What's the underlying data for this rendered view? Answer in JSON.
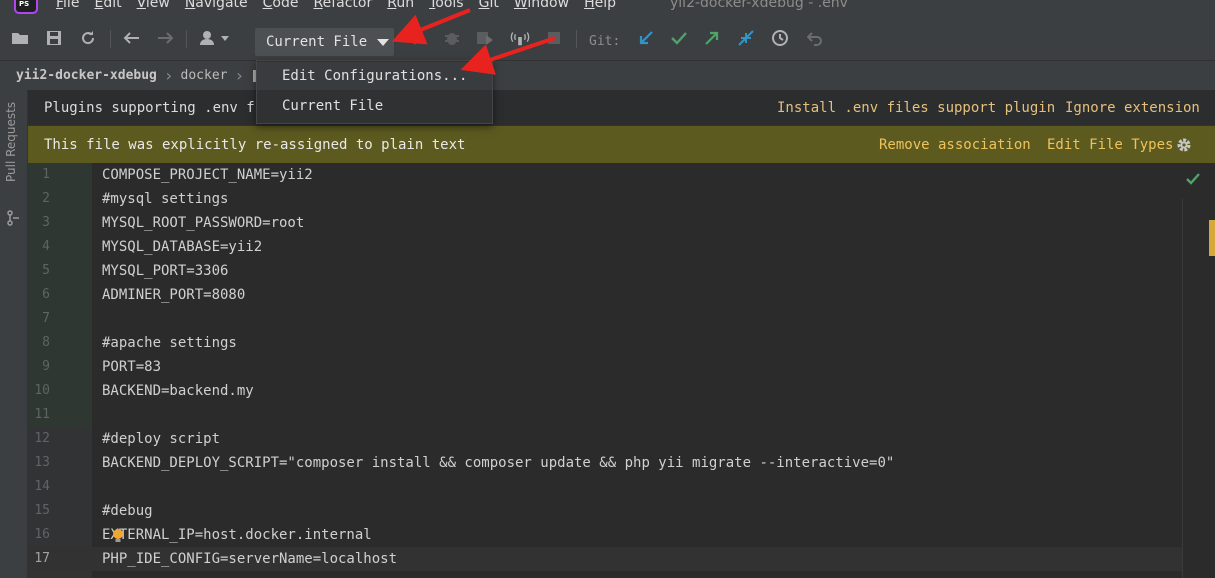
{
  "app": {
    "logo_text": "PS",
    "window_title": "yii2-docker-xdebug - .env"
  },
  "menu": [
    "File",
    "Edit",
    "View",
    "Navigate",
    "Code",
    "Refactor",
    "Run",
    "Tools",
    "Git",
    "Window",
    "Help"
  ],
  "toolbar": {
    "run_config_label": "Current File",
    "git_label": "Git:"
  },
  "run_config_menu": {
    "items": [
      "Edit Configurations...",
      "Current File"
    ]
  },
  "breadcrumb": {
    "project": "yii2-docker-xdebug",
    "folder": "docker"
  },
  "left_strip": {
    "pull_requests_label": "Pull Requests"
  },
  "banner_plugins": {
    "message": "Plugins supporting .env fi",
    "action_install": "Install .env files support plugin",
    "action_ignore": "Ignore extension"
  },
  "banner_plaintext": {
    "message": "This file was explicitly re-assigned to plain text",
    "action_remove": "Remove association",
    "action_edit_types": "Edit File Types"
  },
  "editor": {
    "current_line": 17,
    "lines": [
      {
        "n": "1",
        "text": "COMPOSE_PROJECT_NAME=yii2"
      },
      {
        "n": "2",
        "text": "#mysql settings"
      },
      {
        "n": "3",
        "text": "MYSQL_ROOT_PASSWORD=root"
      },
      {
        "n": "4",
        "text": "MYSQL_DATABASE=yii2"
      },
      {
        "n": "5",
        "text": "MYSQL_PORT=3306"
      },
      {
        "n": "6",
        "text": "ADMINER_PORT=8080"
      },
      {
        "n": "7",
        "text": ""
      },
      {
        "n": "8",
        "text": "#apache settings"
      },
      {
        "n": "9",
        "text": "PORT=83"
      },
      {
        "n": "10",
        "text": "BACKEND=backend.my"
      },
      {
        "n": "11",
        "text": ""
      },
      {
        "n": "12",
        "text": "#deploy script"
      },
      {
        "n": "13",
        "text": "BACKEND_DEPLOY_SCRIPT=\"composer install && composer update && php yii migrate --interactive=0\""
      },
      {
        "n": "14",
        "text": ""
      },
      {
        "n": "15",
        "text": "#debug"
      },
      {
        "n": "16",
        "text": "EXTERNAL_IP=host.docker.internal"
      },
      {
        "n": "17",
        "text": "PHP_IDE_CONFIG=serverName=localhost"
      }
    ]
  },
  "colors": {
    "accent_warning": "#eec35b",
    "annotation_arrow": "#e8231f",
    "check_green": "#4ea36a"
  }
}
